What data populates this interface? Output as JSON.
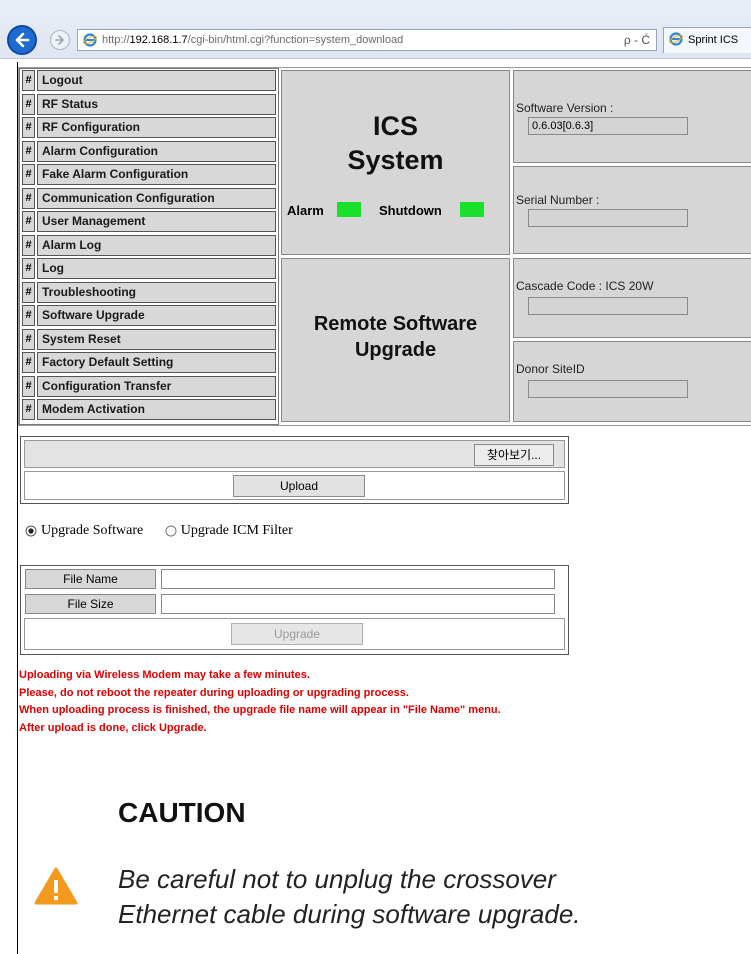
{
  "browser": {
    "url_prefix": "http://",
    "url_host": "192.168.1.7",
    "url_path": "/cgi-bin/html.cgi?function=system_download",
    "addr_tools": "ρ - Ć",
    "tab_title": "Sprint ICS"
  },
  "nav": {
    "hash": "#",
    "items": [
      "Logout",
      "RF Status",
      "RF Configuration",
      "Alarm Configuration",
      "Fake Alarm Configuration",
      "Communication Configuration",
      "User Management",
      "Alarm Log",
      "Log",
      "Troubleshooting",
      "Software Upgrade",
      "System Reset",
      "Factory Default Setting",
      "Configuration Transfer",
      "Modem Activation"
    ]
  },
  "header": {
    "title_line1": "ICS",
    "title_line2": "System",
    "alarm_label": "Alarm",
    "shutdown_label": "Shutdown",
    "alarm_color": "#19e02a",
    "shutdown_color": "#19e02a",
    "section_line1": "Remote Software",
    "section_line2": "Upgrade"
  },
  "info": {
    "software_version_label": "Software Version :",
    "software_version_value": "0.6.03[0.6.3]",
    "serial_number_label": "Serial Number :",
    "serial_number_value": "",
    "cascade_code_label": "Cascade Code : ICS 20W",
    "cascade_code_value": "",
    "donor_siteid_label": "Donor SiteID",
    "donor_siteid_value": ""
  },
  "upload": {
    "browse_label": "찾아보기...",
    "upload_label": "Upload"
  },
  "options": {
    "upgrade_software": "Upgrade Software",
    "upgrade_icm_filter": "Upgrade ICM Filter",
    "selected": "Upgrade Software"
  },
  "file_info": {
    "file_name_label": "File Name",
    "file_name_value": "",
    "file_size_label": "File Size",
    "file_size_value": "",
    "upgrade_label": "Upgrade"
  },
  "notes": [
    "Uploading via Wireless Modem may take a few minutes.",
    "Please, do not reboot the repeater during uploading or upgrading process.",
    "When uploading process is finished, the upgrade file name will appear in \"File Name\" menu.",
    "After upload is done, click Upgrade."
  ],
  "caution": {
    "title": "CAUTION",
    "line1": "Be careful not to unplug the crossover",
    "line2": "Ethernet cable during software upgrade.",
    "icon_color": "#f39a1e"
  }
}
